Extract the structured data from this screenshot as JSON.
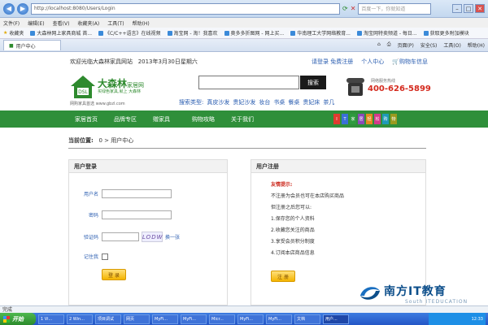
{
  "browser": {
    "url": "http://localhost:8080/Users/Login",
    "search_placeholder": "百度一下，你就知道",
    "menu": [
      "文件(F)",
      "编辑(E)",
      "查看(V)",
      "收藏夹(A)",
      "工具(T)",
      "帮助(H)"
    ],
    "favorites_label": "收藏夹",
    "favorites": [
      "大森林网上家具商城 首...",
      "《C/C++语言》在线视频",
      "淘宝网 - 淘！我喜欢",
      "奥多多折图网 - 网上买...",
      "华南理工大学网络教育...",
      "淘宝网特卖频道 - 每日...",
      "获取更多附加模块"
    ],
    "tab_title": "用户中心",
    "tab_tools": [
      "页面(P)",
      "安全(S)",
      "工具(O)",
      "帮助(H)"
    ]
  },
  "header": {
    "welcome": "欢迎光临大森林家具网站",
    "date": "2013年3月30日星期六",
    "login_link": "请登录",
    "register_link": "免费注册",
    "user_center": "个人中心",
    "cart": "购物车信息"
  },
  "logo": {
    "brand": "大森林",
    "brand_suffix": "家居网",
    "slogan1": "买绿色家具,就上 大森林",
    "slogan2": "网购家具首选 www.gbzl.com"
  },
  "search": {
    "button": "搜索",
    "types_label": "搜索类型:",
    "types": [
      "真皮沙发",
      "贵妃沙发",
      "妆台",
      "书桌",
      "餐桌",
      "贵妃床",
      "茶几"
    ]
  },
  "hotline": {
    "caption": "网络服务热线",
    "number": "400-626-5899"
  },
  "nav": {
    "items": [
      "家居首页",
      "品牌专区",
      "赠家具",
      "购物攻略",
      "关于我们"
    ],
    "blocks": [
      {
        "t": "I",
        "c": "#e03a2f"
      },
      {
        "t": "T",
        "c": "#3a6fd8"
      },
      {
        "t": "家",
        "c": "#2e9a3e"
      },
      {
        "t": "居",
        "c": "#8a4ab8"
      },
      {
        "t": "轻",
        "c": "#e08a1e"
      },
      {
        "t": "松",
        "c": "#d43a8a"
      },
      {
        "t": "购",
        "c": "#1e9ab8"
      },
      {
        "t": "物",
        "c": "#9a9a1e"
      }
    ]
  },
  "location": {
    "label": "当前位置:",
    "path": "0 > 用户中心"
  },
  "login": {
    "title": "用户登录",
    "username_label": "用户名",
    "password_label": "密码",
    "code_label": "验证码",
    "captcha": "LODW",
    "refresh": "换一张",
    "remember_label": "记住我",
    "submit": "登 录"
  },
  "register": {
    "title": "用户注册",
    "tip": "友情提示:",
    "lines": [
      "不注册为会员也可在本店购买商品",
      "但注册之后您可以:",
      "1.保存您的个人资料",
      "2.收藏您关注的商品",
      "3.享受会员积分制度",
      "4.订阅本店商品信息"
    ],
    "button": "注 册"
  },
  "watermark": {
    "title": "南方IT教育",
    "sub": "South ITEDUCATION"
  },
  "statusbar": "完成",
  "taskbar": {
    "start": "开始",
    "tasks": [
      "1 Vi...",
      "2 Win...",
      "项目调试",
      "网页",
      "MyFi...",
      "MyFi...",
      "Micr...",
      "MyFi...",
      "MyFi...",
      "文档",
      "用户..."
    ],
    "clock": "12:33"
  }
}
